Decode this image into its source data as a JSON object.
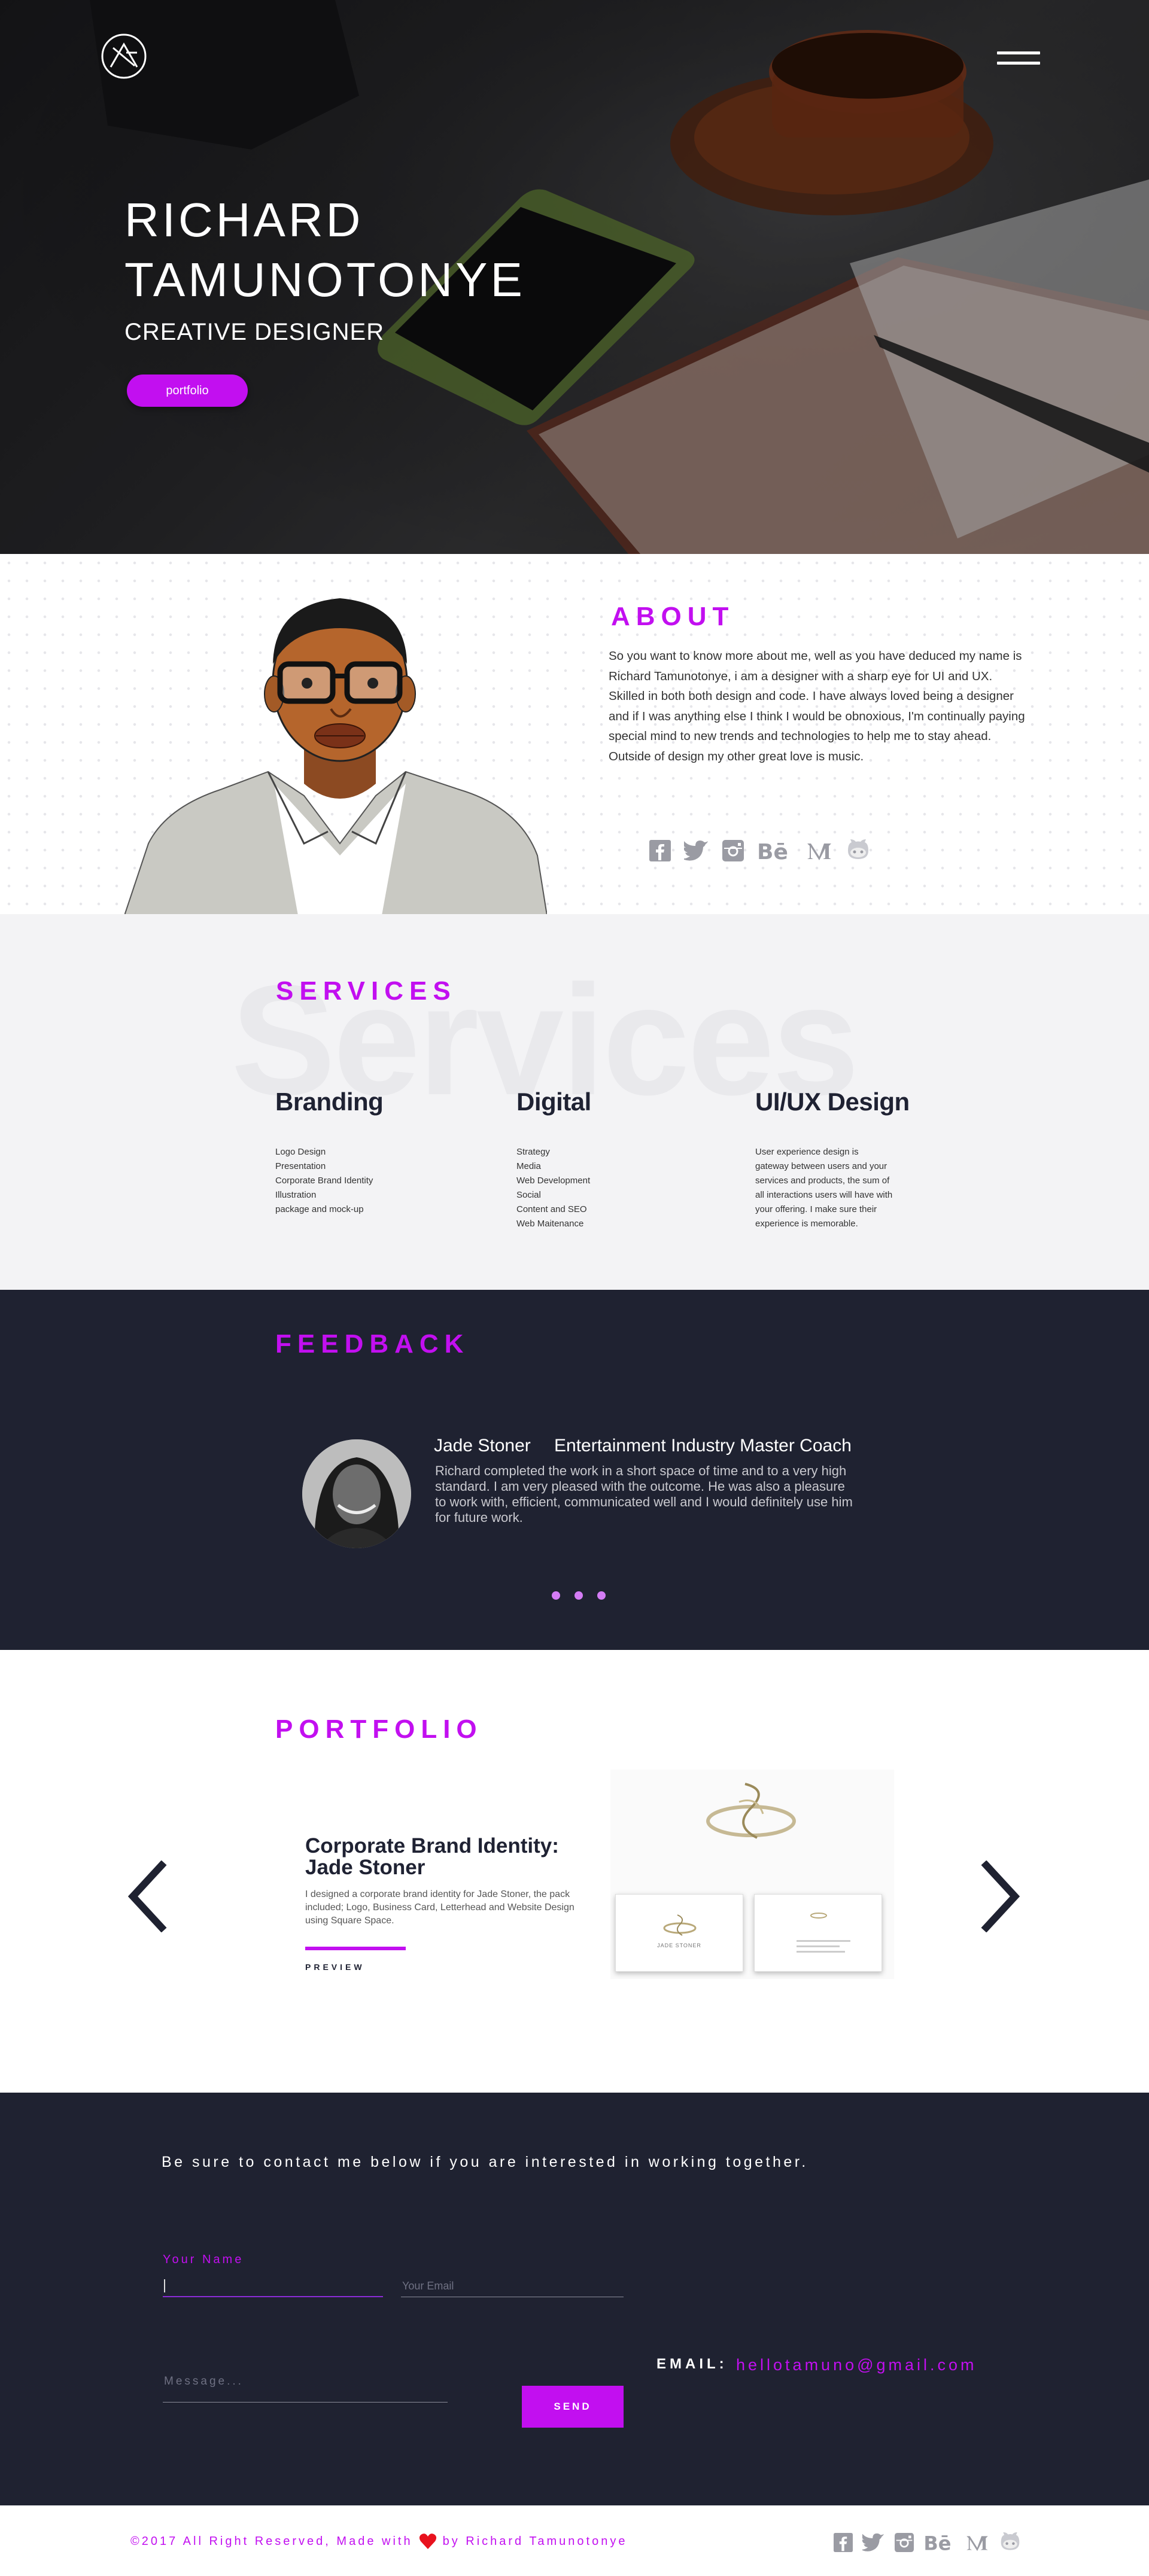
{
  "hero": {
    "name_line1": "RICHARD",
    "name_line2": "TAMUNOTONYE",
    "role": "CREATIVE DESIGNER",
    "portfolio_button": "portfolio",
    "logo_icon": "rt-monogram-logo",
    "menu_icon": "hamburger-menu-icon"
  },
  "about": {
    "title": "ABOUT",
    "text": "So you want to know more about me, well as you have deduced my name is Richard Tamunotonye, i am a  designer with a sharp eye for UI and UX. Skilled in both both design and code. I have always loved being a designer and if I was anything else I think I would be obnoxious, I'm continually paying special mind to new trends and technologies to help me to stay ahead. Outside of design my other great love is music.",
    "social_icons": [
      "facebook-icon",
      "twitter-icon",
      "instagram-icon",
      "behance-icon",
      "medium-icon",
      "github-icon"
    ]
  },
  "services": {
    "title": "SERVICES",
    "watermark": "Services",
    "columns": [
      {
        "heading": "Branding",
        "items": [
          "Logo Design",
          "Presentation",
          "Corporate Brand Identity",
          "Illustration",
          "package and mock-up"
        ]
      },
      {
        "heading": "Digital",
        "items": [
          "Strategy",
          "Media",
          "Web Development",
          "Social",
          "Content and SEO",
          "Web Maitenance"
        ]
      },
      {
        "heading": "UI/UX Design",
        "description": "User experience design is gateway between users and your services and products, the sum of all interactions users will have with your offering. I make sure their experience is memorable."
      }
    ]
  },
  "feedback": {
    "title": "FEEDBACK",
    "name": "Jade Stoner",
    "role": "Entertainment Industry Master Coach",
    "text": "Richard completed the work in a short space of time and to a very high standard. I am very pleased with the outcome. He was also a pleasure to work with, efficient, communicated well and I would definitely use him for future work.",
    "dots": 3
  },
  "portfolio": {
    "title": "PORTFOLIO",
    "item_title": "Corporate Brand Identity: Jade Stoner",
    "item_desc": "I designed a corporate brand identity for Jade Stoner, the pack included; Logo, Business Card, Letterhead and Website Design using Square Space.",
    "preview": "PREVIEW",
    "card_name": "JADE STONER",
    "prev_icon": "chevron-left-icon",
    "next_icon": "chevron-right-icon"
  },
  "contact": {
    "intro": "Be sure to contact me below if you are interested in working together.",
    "name_label": "Your Name",
    "email_placeholder": "Your Email",
    "message_placeholder": "Message...",
    "send": "SEND",
    "email_label": "EMAIL:",
    "email_value": "hellotamuno@gmail.com"
  },
  "footer": {
    "copy_left": "©2017 All Right Reserved, Made with",
    "copy_right": "by Richard Tamunotonye",
    "heart_icon": "heart-icon"
  },
  "colors": {
    "accent": "#c20ff0",
    "dark_bg": "#1f2231",
    "light_bg": "#f3f3f5",
    "social_gray": "#9a9ba3"
  }
}
